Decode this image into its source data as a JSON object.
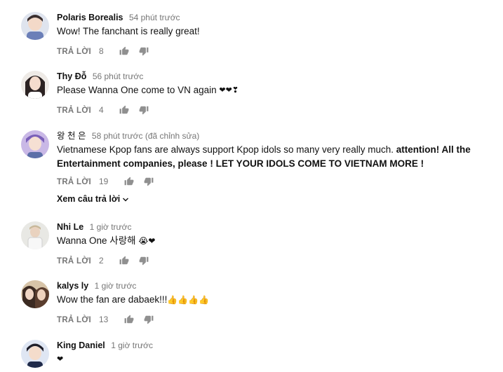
{
  "ui": {
    "reply_label": "TRẢ LỜI",
    "view_replies_label": "Xem câu trả lời",
    "colors": {
      "meta_gray": "#767676",
      "text": "#111111",
      "hand_yellow": "#F4C03A"
    }
  },
  "comments": [
    {
      "author": "Polaris Borealis",
      "time": "54 phút trước",
      "text": "Wow! The fanchant is really great!",
      "likes": "8",
      "avatar": "avatar-polaris"
    },
    {
      "author": "Thy Đỗ",
      "time": "56 phút trước",
      "text": "Please Wanna One come to VN again ",
      "emoji": "❤❤❣",
      "likes": "4",
      "avatar": "avatar-thy"
    },
    {
      "author": "왕 천 은",
      "time": "58 phút trước (đã chỉnh sửa)",
      "text_plain": "Vietnamese Kpop fans are always support Kpop idols so many very really much. ",
      "text_bold": "attention! All the Entertainment companies, please ! LET YOUR IDOLS COME TO VIETNAM MORE !",
      "likes": "19",
      "avatar": "avatar-wang"
    },
    {
      "author": "Nhi Le",
      "time": "1 giờ trước",
      "text": "Wanna One 사랑해 ",
      "emoji": "😭❤",
      "likes": "2",
      "avatar": "avatar-nhi"
    },
    {
      "author": "kalys ly",
      "time": "1 giờ trước",
      "text": "Wow the fan are dabaek!!!",
      "emoji": "👍👍👍👍",
      "likes": "13",
      "avatar": "avatar-kalys"
    },
    {
      "author": "King Daniel",
      "time": "1 giờ trước",
      "text": "",
      "emoji": "❤",
      "avatar": "avatar-daniel"
    }
  ]
}
